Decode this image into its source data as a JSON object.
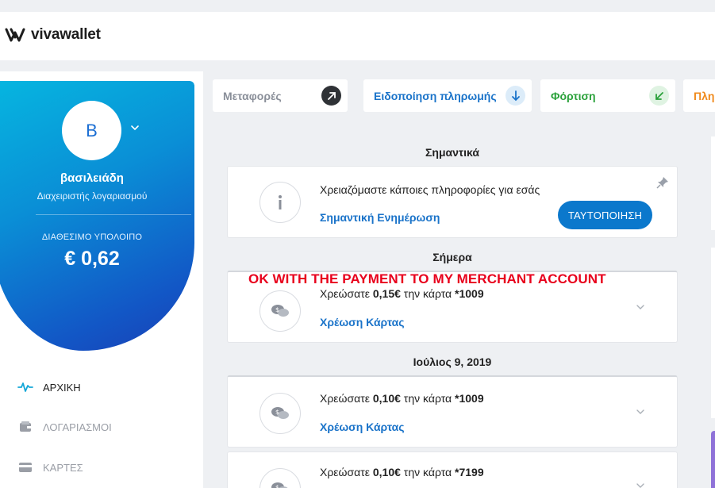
{
  "brand": {
    "logo_part1": "viva",
    "logo_part2": "wallet"
  },
  "profile": {
    "avatar_initial": "B",
    "name": "βασιλειάδη",
    "role": "Διαχειριστής λογαριασμού",
    "balance_label": "ΔΙΑΘΕΣΙΜΟ ΥΠΟΛΟΙΠΟ",
    "balance_value": "€ 0,62"
  },
  "nav": [
    {
      "label": "ΑΡΧΙΚΗ",
      "icon": "pulse-icon",
      "active": true
    },
    {
      "label": "ΛΟΓΑΡΙΑΣΜΟΙ",
      "icon": "wallet-icon",
      "active": false
    },
    {
      "label": "ΚΑΡΤΕΣ",
      "icon": "card-icon",
      "active": false
    }
  ],
  "actions": [
    {
      "label": "Μεταφορές",
      "icon": "arrow-up-right-icon",
      "color": "#8a8f99"
    },
    {
      "label": "Ειδοποίηση πληρωμής",
      "icon": "arrow-down-icon",
      "color": "#1a73c9"
    },
    {
      "label": "Φόρτιση",
      "icon": "arrow-down-left-icon",
      "color": "#2aa13a"
    },
    {
      "label": "Πλη",
      "icon": "",
      "color": "#f08a1c"
    }
  ],
  "sections": {
    "important": "Σημαντικά",
    "today": "Σήμερα",
    "july": "Ιούλιος 9, 2019"
  },
  "important_card": {
    "text": "Χρειαζόμαστε κάποιες πληροφορίες για εσάς",
    "link": "Σημαντική Ενημέρωση",
    "button": "ΤΑΥΤΟΠΟΙΗΣΗ"
  },
  "transactions": [
    {
      "prefix": "Χρεώσατε ",
      "amount": "0,15€",
      "middle": " την κάρτα ",
      "card": "*1009",
      "type": "Χρέωση Κάρτας"
    },
    {
      "prefix": "Χρεώσατε ",
      "amount": "0,10€",
      "middle": " την κάρτα ",
      "card": "*1009",
      "type": "Χρέωση Κάρτας"
    },
    {
      "prefix": "Χρεώσατε ",
      "amount": "0,10€",
      "middle": " την κάρτα ",
      "card": "*7199",
      "type": ""
    }
  ],
  "annotation": "OK WITH THE PAYMENT TO MY MERCHANT ACCOUNT"
}
